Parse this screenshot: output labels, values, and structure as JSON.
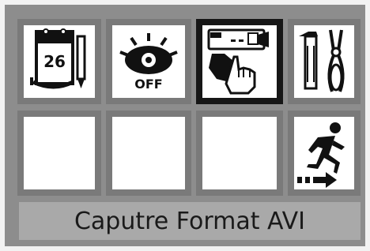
{
  "menu": {
    "items": [
      {
        "icon": "calendar-date-icon",
        "label": "26"
      },
      {
        "icon": "eye-off-icon",
        "label": "OFF"
      },
      {
        "icon": "video-capture-icon",
        "label": ""
      },
      {
        "icon": "tools-icon",
        "label": ""
      },
      {
        "icon": "empty",
        "label": ""
      },
      {
        "icon": "empty",
        "label": ""
      },
      {
        "icon": "empty",
        "label": ""
      },
      {
        "icon": "exit-running-man-icon",
        "label": ""
      }
    ],
    "selected_index": 2
  },
  "status": {
    "text": "Caputre Format AVI"
  },
  "colors": {
    "tile_border": "#7a7a7a",
    "selected_border": "#161616",
    "status_bg": "#a9a9a9"
  }
}
